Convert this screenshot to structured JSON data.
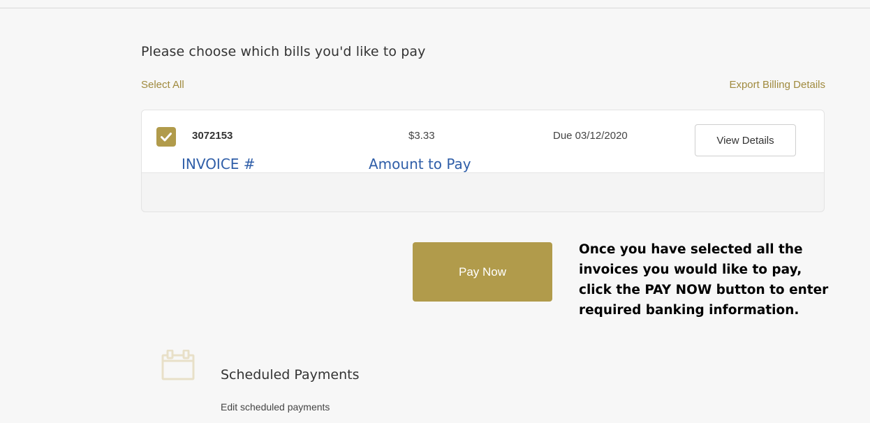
{
  "bills": {
    "heading": "Please choose which bills you'd like to pay",
    "select_all": "Select All",
    "export_label": "Export Billing Details",
    "items": [
      {
        "invoice": "3072153",
        "amount": "$3.33",
        "due": "Due 03/12/2020",
        "checked": true,
        "view_details": "View Details"
      }
    ]
  },
  "annotations": {
    "invoice_label": "INVOICE #",
    "amount_label": "Amount to Pay",
    "instruction_lines": [
      "Once you have selected all the",
      "invoices you would like to pay,",
      "click the PAY NOW button to enter",
      "required banking information."
    ]
  },
  "actions": {
    "pay_now": "Pay Now"
  },
  "scheduled": {
    "title": "Scheduled Payments",
    "subtitle": "Edit scheduled payments"
  },
  "icons": {
    "checkbox": "checkmark-icon",
    "scheduled": "calendar-icon"
  },
  "colors": {
    "accent": "#b19b4b",
    "link": "#a08a3e",
    "annotation": "#2f5ea8"
  }
}
